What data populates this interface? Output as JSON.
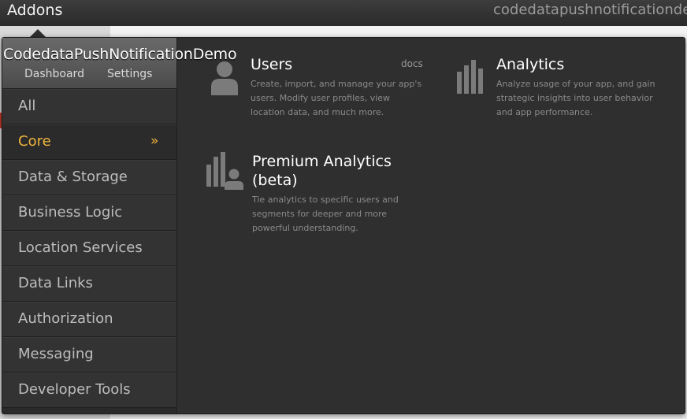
{
  "topbar": {
    "title": "Addons",
    "app_name": "codedatapushnotificationdemo"
  },
  "sidebar": {
    "app_name": "CodedataPushNotificationDemo",
    "dashboard_label": "Dashboard",
    "settings_label": "Settings",
    "items": [
      {
        "label": "All"
      },
      {
        "label": "Core",
        "active": true,
        "chevron": "»"
      },
      {
        "label": "Data & Storage"
      },
      {
        "label": "Business Logic"
      },
      {
        "label": "Location Services"
      },
      {
        "label": "Data Links"
      },
      {
        "label": "Authorization"
      },
      {
        "label": "Messaging"
      },
      {
        "label": "Developer Tools"
      }
    ]
  },
  "addons": [
    {
      "icon": "user-icon",
      "title": "Users",
      "docs_label": "docs",
      "description_lines": [
        "Create, import, and manage your app's",
        "users. Modify user profiles, view",
        "location data, and much more."
      ]
    },
    {
      "icon": "bar-chart-icon",
      "title": "Analytics",
      "description_lines": [
        "Analyze usage of your app, and gain",
        "strategic insights into user behavior",
        "and app performance."
      ]
    },
    {
      "icon": "user-analytics-icon",
      "title_lines": [
        "Premium Analytics",
        "(beta)"
      ],
      "description_lines": [
        "Tie analytics to specific users and",
        "segments for deeper and more",
        "powerful understanding."
      ]
    }
  ],
  "colors": {
    "accent": "#f0b43c",
    "panel_bg": "#2f2f2f",
    "topbar_bg": "#333333"
  }
}
